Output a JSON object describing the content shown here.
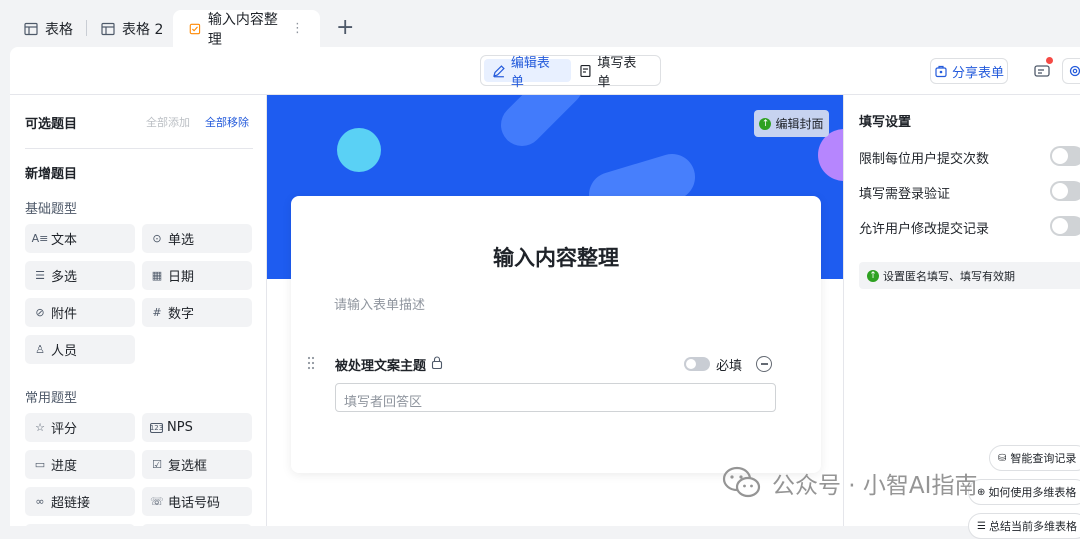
{
  "tabs": [
    {
      "label": "表格",
      "icon": "table-icon"
    },
    {
      "label": "表格 2",
      "icon": "table-icon"
    },
    {
      "label": "输入内容整理",
      "icon": "form-icon",
      "active": true
    }
  ],
  "toolbar": {
    "edit_form": "编辑表单",
    "fill_form": "填写表单",
    "share_form": "分享表单"
  },
  "left_panel": {
    "title": "可选题目",
    "add_all": "全部添加",
    "remove_all": "全部移除",
    "new_question": "新增题目",
    "basic_types": "基础题型",
    "basic_items": [
      {
        "label": "文本",
        "icon": "text-icon"
      },
      {
        "label": "单选",
        "icon": "single-select-icon"
      },
      {
        "label": "多选",
        "icon": "multi-select-icon"
      },
      {
        "label": "日期",
        "icon": "calendar-icon"
      },
      {
        "label": "附件",
        "icon": "paperclip-icon"
      },
      {
        "label": "数字",
        "icon": "hash-icon"
      },
      {
        "label": "人员",
        "icon": "person-icon"
      }
    ],
    "common_types": "常用题型",
    "common_items": [
      {
        "label": "评分",
        "icon": "star-icon"
      },
      {
        "label": "NPS",
        "icon": "nps-icon"
      },
      {
        "label": "进度",
        "icon": "progress-icon"
      },
      {
        "label": "复选框",
        "icon": "checkbox-icon"
      },
      {
        "label": "超链接",
        "icon": "link-icon"
      },
      {
        "label": "电话号码",
        "icon": "phone-icon"
      }
    ]
  },
  "form": {
    "edit_cover": "编辑封面",
    "title": "输入内容整理",
    "description_placeholder": "请输入表单描述",
    "question_label": "被处理文案主题",
    "required_label": "必填",
    "answer_placeholder": "填写者回答区",
    "colors": {
      "cover": "#1e5cf0",
      "accent": "#245bdb"
    }
  },
  "right_panel": {
    "title": "填写设置",
    "settings": [
      {
        "label": "限制每位用户提交次数",
        "enabled": false
      },
      {
        "label": "填写需登录验证",
        "enabled": false
      },
      {
        "label": "允许用户修改提交记录",
        "enabled": false
      }
    ],
    "anonymous_setting": "设置匿名填写、填写有效期",
    "floating": [
      {
        "label": "智能查询记录",
        "icon": "query-icon"
      },
      {
        "label": "如何使用多维表格",
        "icon": "help-icon"
      },
      {
        "label": "总结当前多维表格",
        "icon": "summary-icon"
      }
    ]
  },
  "watermark": "公众号 · 小智AI指南"
}
